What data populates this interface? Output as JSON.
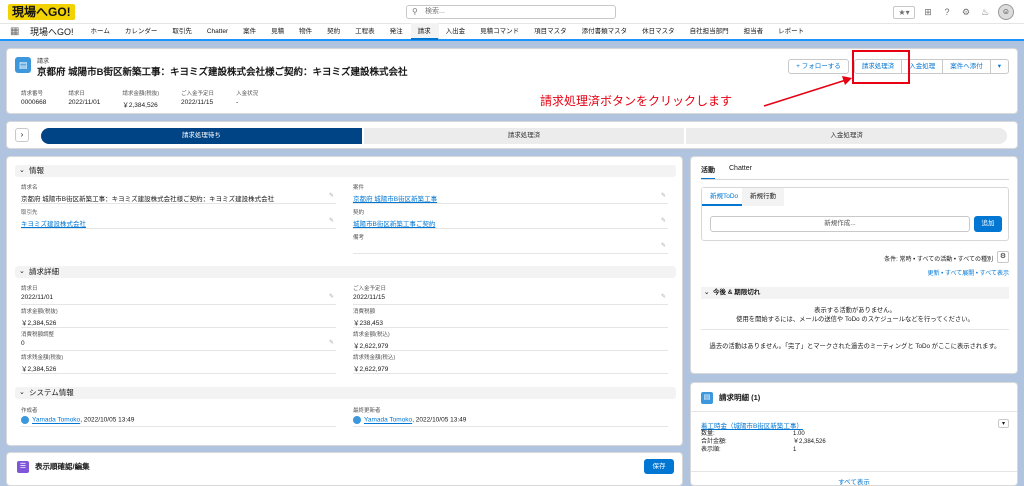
{
  "header": {
    "logo": "現場へGO!",
    "search_placeholder": "検索...",
    "app_name": "現場へGO!",
    "nav": [
      "ホーム",
      "カレンダー",
      "取引先",
      "Chatter",
      "案件",
      "見積",
      "物件",
      "契約",
      "工程表",
      "発注",
      "請求",
      "入出金",
      "見積コマンド",
      "項目マスタ",
      "添付書類マスタ",
      "休日マスタ",
      "自社担当部門",
      "担当者",
      "レポート"
    ],
    "active_nav": "請求"
  },
  "record": {
    "type": "請求",
    "title": "京都府 城陽市B街区新築工事：キヨミズ建設株式会社様ご契約：キヨミズ建設株式会社",
    "buttons": {
      "follow": "+ フォローする",
      "process": "請求処理済",
      "payment": "入金処理",
      "attach": "案件へ添付"
    },
    "highlights": [
      {
        "label": "請求番号",
        "value": "0000668"
      },
      {
        "label": "請求日",
        "value": "2022/11/01"
      },
      {
        "label": "請求金額(税抜)",
        "value": "￥2,384,526"
      },
      {
        "label": "ご入金予定日",
        "value": "2022/11/15"
      },
      {
        "label": "入金状況",
        "value": "-"
      }
    ]
  },
  "annotation": "請求処理済ボタンをクリックします",
  "path": [
    "請求処理待ち",
    "請求処理済",
    "入金処理済"
  ],
  "info": {
    "title": "情報",
    "fields": {
      "name_label": "請求名",
      "name_value": "京都府 城陽市B街区新築工事：キヨミズ建設株式会社様ご契約：キヨミズ建設株式会社",
      "project_label": "案件",
      "project_value": "京都府 城陽市B街区新築工事",
      "account_label": "取引先",
      "account_value": "キヨミズ建設株式会社",
      "contract_label": "契約",
      "contract_value": "城陽市B街区新築工事ご契約",
      "note_label": "備考"
    }
  },
  "detail": {
    "title": "請求詳細",
    "rows": [
      {
        "label": "請求日",
        "value": "2022/11/01"
      },
      {
        "label": "ご入金予定日",
        "value": "2022/11/15"
      },
      {
        "label": "請求金額(税抜)",
        "value": "￥2,384,526"
      },
      {
        "label": "消費税額",
        "value": "￥238,453"
      },
      {
        "label": "消費税額調整",
        "value": "0"
      },
      {
        "label": "請求金額(税込)",
        "value": "￥2,622,979"
      },
      {
        "label": "請求残金額(税抜)",
        "value": "￥2,384,526"
      },
      {
        "label": "請求残金額(税込)",
        "value": "￥2,622,979"
      }
    ]
  },
  "system": {
    "title": "システム情報",
    "created_label": "作成者",
    "created_user": "Yamada Tomoko",
    "created_at": ", 2022/10/05 13:49",
    "modified_label": "最終更新者",
    "modified_user": "Yamada Tomoko",
    "modified_at": ", 2022/10/05 13:49"
  },
  "activity": {
    "tabs": [
      "活動",
      "Chatter"
    ],
    "subtabs": [
      "新規ToDo",
      "新規行動"
    ],
    "new_task_placeholder": "新規作成...",
    "add": "追加",
    "filter": "条件: 常時 • すべての活動 • すべての種別",
    "links": "更新 • すべて展開 • すべて表示",
    "upcoming": "今後 & 期限切れ",
    "empty1": "表示する活動がありません。",
    "empty2": "使用を開始するには、メールの送信や ToDo のスケジュールなどを行ってください。",
    "past": "過去の活動はありません。「完了」とマークされた過去のミーティングと ToDo がここに表示されます。"
  },
  "invoice_lines": {
    "title": "請求明細 (1)",
    "item": "着工時金（城陽市B街区新築工事）",
    "rows": [
      {
        "k": "数量:",
        "v": "1.00"
      },
      {
        "k": "合計金額:",
        "v": "￥2,384,526"
      },
      {
        "k": "表示順:",
        "v": "1"
      }
    ],
    "show_all": "すべて表示"
  },
  "bottom": {
    "title": "表示順確認/編集",
    "save": "保存"
  }
}
